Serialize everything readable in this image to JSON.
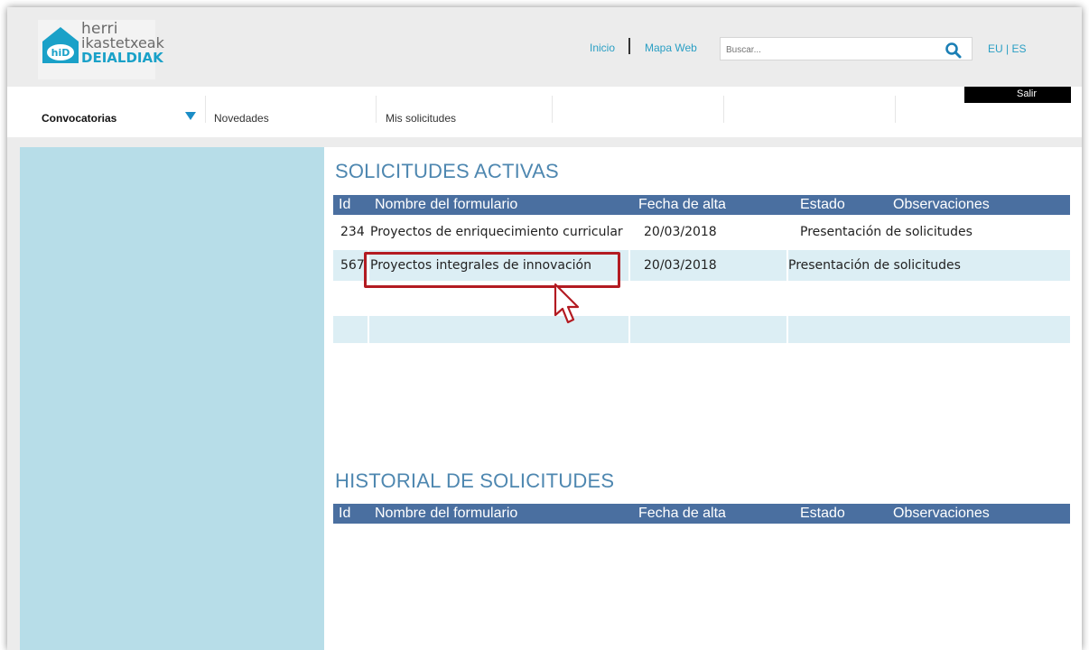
{
  "header": {
    "logo": {
      "line1": "herri",
      "line2": "ikastetxeak",
      "line3": "DEIALDIAK",
      "badge": "hiD",
      "accent": "#1aa1c8"
    },
    "links": {
      "inicio": "Inicio",
      "mapa": "Mapa Web"
    },
    "search": {
      "placeholder": "Buscar..."
    },
    "lang": "EU | ES"
  },
  "nav": {
    "items": [
      "Convocatorias",
      "Novedades",
      "Mis solicitudes"
    ],
    "salir": "Salir"
  },
  "activas": {
    "title": "SOLICITUDES ACTIVAS",
    "columns": [
      "Id",
      "Nombre del formulario",
      "Fecha de alta",
      "Estado",
      "Observaciones"
    ],
    "rows": [
      {
        "id": "234",
        "nombre": "Proyectos de enriquecimiento curricular",
        "fecha": "20/03/2018",
        "estado": "Presentación de solicitudes"
      },
      {
        "id": "567",
        "nombre": "Proyectos integrales de innovación",
        "fecha": "20/03/2018",
        "estado": "Presentación de solicitudes"
      }
    ]
  },
  "historial": {
    "title": "HISTORIAL DE SOLICITUDES",
    "columns": [
      "Id",
      "Nombre del formulario",
      "Fecha de alta",
      "Estado",
      "Observaciones"
    ]
  },
  "colors": {
    "table_header": "#4a6fa0",
    "sidebar": "#b7dde8",
    "highlight": "#b31b22",
    "link": "#2a9fc4"
  }
}
